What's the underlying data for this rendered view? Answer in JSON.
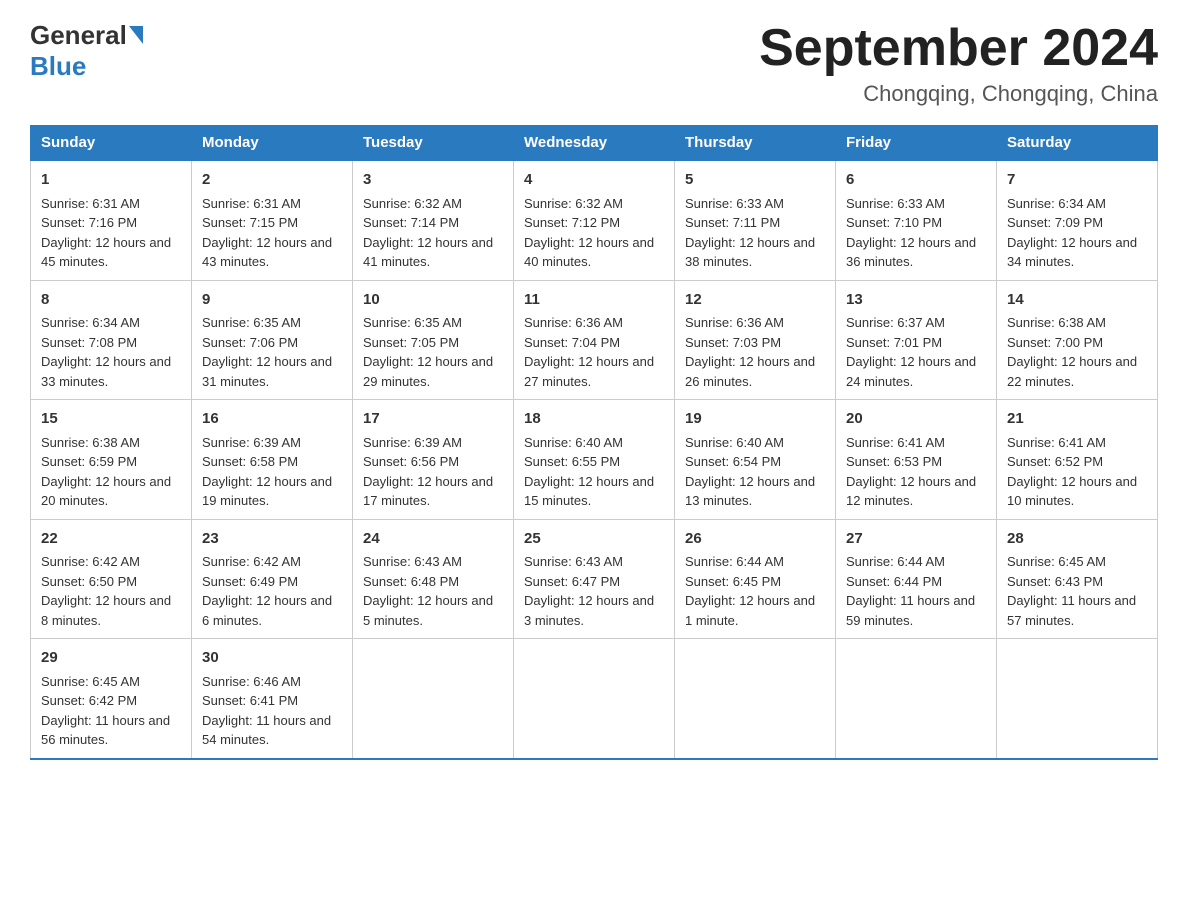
{
  "header": {
    "logo_general": "General",
    "logo_blue": "Blue",
    "title": "September 2024",
    "subtitle": "Chongqing, Chongqing, China"
  },
  "days_of_week": [
    "Sunday",
    "Monday",
    "Tuesday",
    "Wednesday",
    "Thursday",
    "Friday",
    "Saturday"
  ],
  "weeks": [
    [
      {
        "day": "1",
        "sunrise": "Sunrise: 6:31 AM",
        "sunset": "Sunset: 7:16 PM",
        "daylight": "Daylight: 12 hours and 45 minutes."
      },
      {
        "day": "2",
        "sunrise": "Sunrise: 6:31 AM",
        "sunset": "Sunset: 7:15 PM",
        "daylight": "Daylight: 12 hours and 43 minutes."
      },
      {
        "day": "3",
        "sunrise": "Sunrise: 6:32 AM",
        "sunset": "Sunset: 7:14 PM",
        "daylight": "Daylight: 12 hours and 41 minutes."
      },
      {
        "day": "4",
        "sunrise": "Sunrise: 6:32 AM",
        "sunset": "Sunset: 7:12 PM",
        "daylight": "Daylight: 12 hours and 40 minutes."
      },
      {
        "day": "5",
        "sunrise": "Sunrise: 6:33 AM",
        "sunset": "Sunset: 7:11 PM",
        "daylight": "Daylight: 12 hours and 38 minutes."
      },
      {
        "day": "6",
        "sunrise": "Sunrise: 6:33 AM",
        "sunset": "Sunset: 7:10 PM",
        "daylight": "Daylight: 12 hours and 36 minutes."
      },
      {
        "day": "7",
        "sunrise": "Sunrise: 6:34 AM",
        "sunset": "Sunset: 7:09 PM",
        "daylight": "Daylight: 12 hours and 34 minutes."
      }
    ],
    [
      {
        "day": "8",
        "sunrise": "Sunrise: 6:34 AM",
        "sunset": "Sunset: 7:08 PM",
        "daylight": "Daylight: 12 hours and 33 minutes."
      },
      {
        "day": "9",
        "sunrise": "Sunrise: 6:35 AM",
        "sunset": "Sunset: 7:06 PM",
        "daylight": "Daylight: 12 hours and 31 minutes."
      },
      {
        "day": "10",
        "sunrise": "Sunrise: 6:35 AM",
        "sunset": "Sunset: 7:05 PM",
        "daylight": "Daylight: 12 hours and 29 minutes."
      },
      {
        "day": "11",
        "sunrise": "Sunrise: 6:36 AM",
        "sunset": "Sunset: 7:04 PM",
        "daylight": "Daylight: 12 hours and 27 minutes."
      },
      {
        "day": "12",
        "sunrise": "Sunrise: 6:36 AM",
        "sunset": "Sunset: 7:03 PM",
        "daylight": "Daylight: 12 hours and 26 minutes."
      },
      {
        "day": "13",
        "sunrise": "Sunrise: 6:37 AM",
        "sunset": "Sunset: 7:01 PM",
        "daylight": "Daylight: 12 hours and 24 minutes."
      },
      {
        "day": "14",
        "sunrise": "Sunrise: 6:38 AM",
        "sunset": "Sunset: 7:00 PM",
        "daylight": "Daylight: 12 hours and 22 minutes."
      }
    ],
    [
      {
        "day": "15",
        "sunrise": "Sunrise: 6:38 AM",
        "sunset": "Sunset: 6:59 PM",
        "daylight": "Daylight: 12 hours and 20 minutes."
      },
      {
        "day": "16",
        "sunrise": "Sunrise: 6:39 AM",
        "sunset": "Sunset: 6:58 PM",
        "daylight": "Daylight: 12 hours and 19 minutes."
      },
      {
        "day": "17",
        "sunrise": "Sunrise: 6:39 AM",
        "sunset": "Sunset: 6:56 PM",
        "daylight": "Daylight: 12 hours and 17 minutes."
      },
      {
        "day": "18",
        "sunrise": "Sunrise: 6:40 AM",
        "sunset": "Sunset: 6:55 PM",
        "daylight": "Daylight: 12 hours and 15 minutes."
      },
      {
        "day": "19",
        "sunrise": "Sunrise: 6:40 AM",
        "sunset": "Sunset: 6:54 PM",
        "daylight": "Daylight: 12 hours and 13 minutes."
      },
      {
        "day": "20",
        "sunrise": "Sunrise: 6:41 AM",
        "sunset": "Sunset: 6:53 PM",
        "daylight": "Daylight: 12 hours and 12 minutes."
      },
      {
        "day": "21",
        "sunrise": "Sunrise: 6:41 AM",
        "sunset": "Sunset: 6:52 PM",
        "daylight": "Daylight: 12 hours and 10 minutes."
      }
    ],
    [
      {
        "day": "22",
        "sunrise": "Sunrise: 6:42 AM",
        "sunset": "Sunset: 6:50 PM",
        "daylight": "Daylight: 12 hours and 8 minutes."
      },
      {
        "day": "23",
        "sunrise": "Sunrise: 6:42 AM",
        "sunset": "Sunset: 6:49 PM",
        "daylight": "Daylight: 12 hours and 6 minutes."
      },
      {
        "day": "24",
        "sunrise": "Sunrise: 6:43 AM",
        "sunset": "Sunset: 6:48 PM",
        "daylight": "Daylight: 12 hours and 5 minutes."
      },
      {
        "day": "25",
        "sunrise": "Sunrise: 6:43 AM",
        "sunset": "Sunset: 6:47 PM",
        "daylight": "Daylight: 12 hours and 3 minutes."
      },
      {
        "day": "26",
        "sunrise": "Sunrise: 6:44 AM",
        "sunset": "Sunset: 6:45 PM",
        "daylight": "Daylight: 12 hours and 1 minute."
      },
      {
        "day": "27",
        "sunrise": "Sunrise: 6:44 AM",
        "sunset": "Sunset: 6:44 PM",
        "daylight": "Daylight: 11 hours and 59 minutes."
      },
      {
        "day": "28",
        "sunrise": "Sunrise: 6:45 AM",
        "sunset": "Sunset: 6:43 PM",
        "daylight": "Daylight: 11 hours and 57 minutes."
      }
    ],
    [
      {
        "day": "29",
        "sunrise": "Sunrise: 6:45 AM",
        "sunset": "Sunset: 6:42 PM",
        "daylight": "Daylight: 11 hours and 56 minutes."
      },
      {
        "day": "30",
        "sunrise": "Sunrise: 6:46 AM",
        "sunset": "Sunset: 6:41 PM",
        "daylight": "Daylight: 11 hours and 54 minutes."
      },
      null,
      null,
      null,
      null,
      null
    ]
  ]
}
